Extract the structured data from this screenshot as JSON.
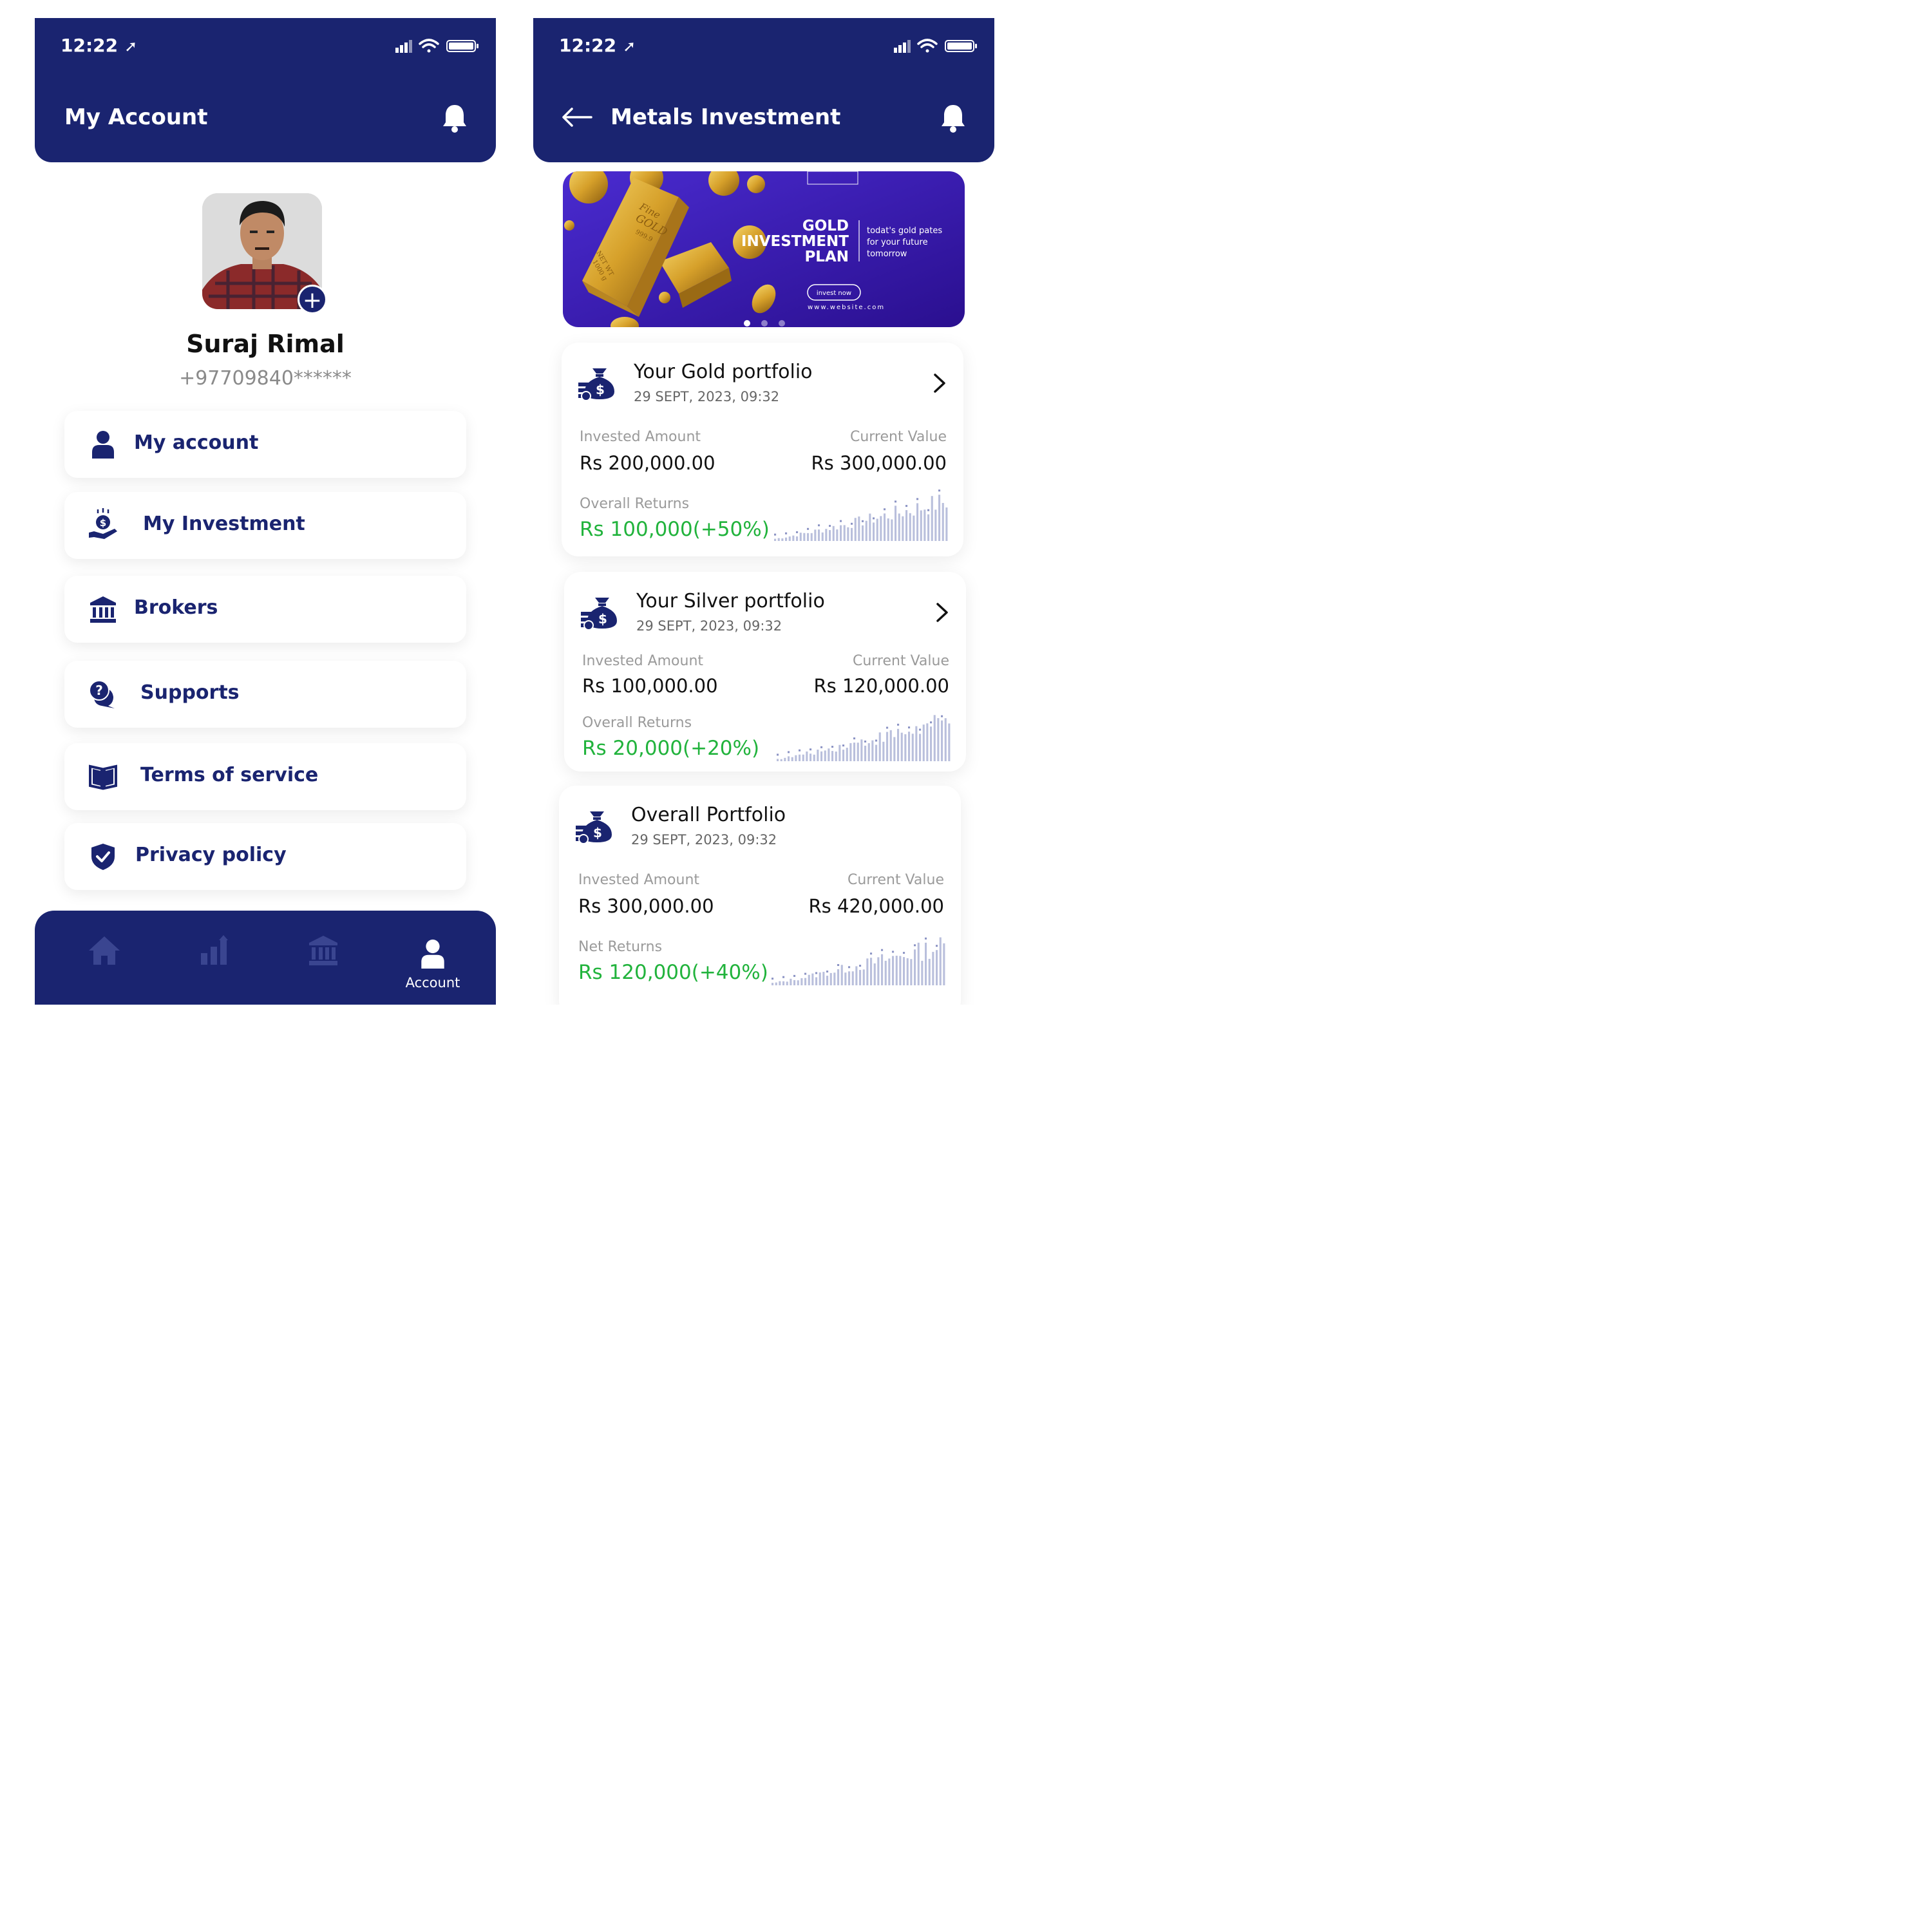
{
  "left": {
    "status": {
      "time": "12:22"
    },
    "header": {
      "title": "My Account"
    },
    "profile": {
      "name": "Suraj Rimal",
      "phone": "+97709840******"
    },
    "menu": [
      {
        "label": "My account",
        "icon": "person-icon"
      },
      {
        "label": "My Investment",
        "icon": "investment-hand-icon"
      },
      {
        "label": "Brokers",
        "icon": "bank-icon"
      },
      {
        "label": "Supports",
        "icon": "support-chat-icon"
      },
      {
        "label": "Terms of service",
        "icon": "book-icon"
      },
      {
        "label": "Privacy policy",
        "icon": "shield-check-icon"
      }
    ],
    "nav": {
      "active_label": "Account"
    }
  },
  "right": {
    "status": {
      "time": "12:22"
    },
    "header": {
      "title": "Metals Investment"
    },
    "banner": {
      "title_lines": [
        "GOLD",
        "INVESTMENT",
        "PLAN"
      ],
      "tagline_lines": [
        "todat's gold pates",
        "for your future",
        "tomorrow"
      ],
      "button": "invest now",
      "website": "www.website.com",
      "bar_text_1": "Fine",
      "bar_text_2": "GOLD",
      "bar_text_3": "999.9",
      "bar_text_4": "NET WT",
      "bar_text_5": "1000 g",
      "carousel_active": 1,
      "carousel_total": 3
    },
    "cards": [
      {
        "title": "Your Gold portfolio",
        "date": "29 SEPT, 2023, 09:32",
        "invested_label": "Invested Amount",
        "invested": "Rs 200,000.00",
        "current_label": "Current Value",
        "current": "Rs 300,000.00",
        "returns_label": "Overall Returns",
        "returns": "Rs 100,000(+50%)"
      },
      {
        "title": "Your Silver portfolio",
        "date": "29 SEPT, 2023, 09:32",
        "invested_label": "Invested Amount",
        "invested": "Rs 100,000.00",
        "current_label": "Current Value",
        "current": "Rs 120,000.00",
        "returns_label": "Overall Returns",
        "returns": "Rs 20,000(+20%)"
      },
      {
        "title": "Overall Portfolio",
        "date": "29 SEPT, 2023, 09:32",
        "invested_label": "Invested Amount",
        "invested": "Rs 300,000.00",
        "current_label": "Current Value",
        "current": "Rs 420,000.00",
        "returns_label": "Net  Returns",
        "returns": "Rs 120,000(+40%)"
      }
    ]
  },
  "colors": {
    "primary": "#1a2470",
    "positive": "#21b33c",
    "sparkline": "#b9bfdc",
    "banner": "#3b1fbf",
    "gold": "#d9a62a"
  }
}
